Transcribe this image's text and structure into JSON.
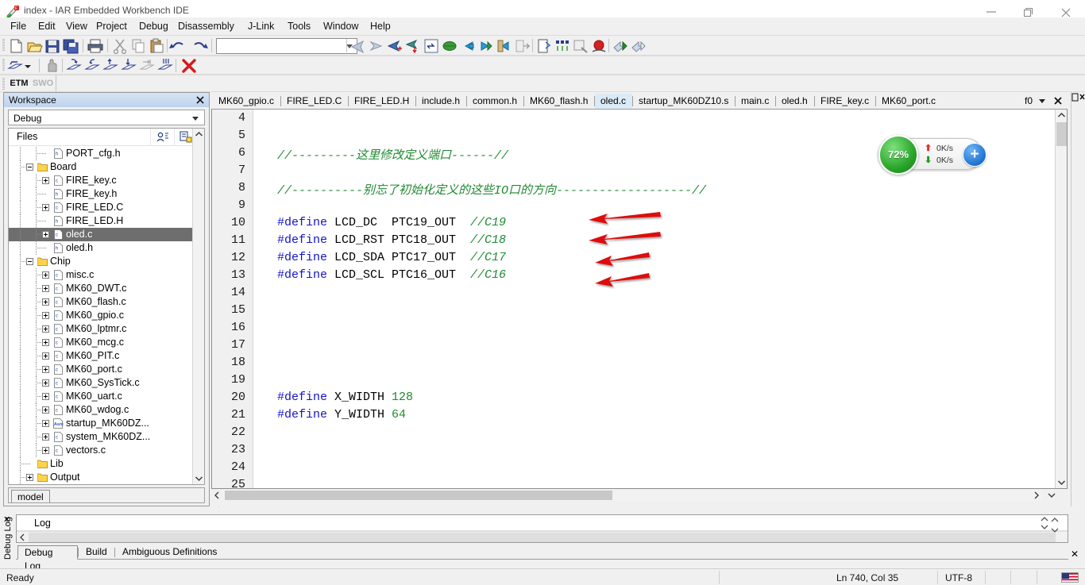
{
  "window": {
    "title": "index - IAR Embedded Workbench IDE",
    "app_icon": "iar-workbench-icon",
    "minimize": "─",
    "maximize": "❐",
    "close": "✕"
  },
  "menubar": {
    "items": [
      {
        "label": "File"
      },
      {
        "label": "Edit"
      },
      {
        "label": "View"
      },
      {
        "label": "Project"
      },
      {
        "label": "Debug"
      },
      {
        "label": "Disassembly"
      },
      {
        "label": "J-Link"
      },
      {
        "label": "Tools"
      },
      {
        "label": "Window"
      },
      {
        "label": "Help"
      }
    ]
  },
  "toolbar": {
    "main_icons": [
      "new-document-icon",
      "open-folder-icon",
      "save-icon",
      "save-all-icon",
      "print-icon",
      "cut-scissors-icon",
      "copy-icon",
      "paste-icon",
      "undo-icon",
      "redo-icon"
    ],
    "search_combo_value": "",
    "debug_icons": [
      "reset-icon",
      "break-icon",
      "step-over-icon",
      "step-into-icon",
      "step-out-icon",
      "next-statement-icon",
      "run-to-cursor-icon",
      "go-back-icon",
      "go-forward-icon",
      "goto-icon",
      "navigate-icon",
      "bookmark-icon",
      "toggle-breakpoint-icon",
      "view-breakpoints-icon",
      "stop-debug-icon",
      "download-debug-icon",
      "debug-without-download-icon"
    ],
    "debug_row_icons": [
      "step-dropdown-icon",
      "hand-icon",
      "step-over-2-icon",
      "step-into-2-icon",
      "step-out-2-icon",
      "next-stmt-2-icon",
      "run-to-cursor-2-icon",
      "multi-step-icon",
      "stop-debug-x-icon"
    ],
    "trace_buttons": [
      {
        "label": "ETM",
        "enabled": true
      },
      {
        "label": "SWO",
        "enabled": false
      }
    ]
  },
  "workspace": {
    "title": "Workspace",
    "close_icon": "close-icon",
    "config_value": "Debug",
    "files_header": "Files",
    "header_icons": [
      "user-config-icon",
      "build-config-icon"
    ],
    "bottom_tab": "model",
    "tree": [
      {
        "label": "PORT_cfg.h",
        "indent": 2,
        "icon": "header-file-icon",
        "expand": "none",
        "selected": false
      },
      {
        "label": "Board",
        "indent": 1,
        "icon": "folder-icon",
        "expand": "minus",
        "selected": false
      },
      {
        "label": "FIRE_key.c",
        "indent": 2,
        "icon": "c-file-icon",
        "expand": "plus",
        "selected": false
      },
      {
        "label": "FIRE_key.h",
        "indent": 2,
        "icon": "header-file-icon",
        "expand": "none",
        "selected": false
      },
      {
        "label": "FIRE_LED.C",
        "indent": 2,
        "icon": "c-file-icon",
        "expand": "plus",
        "selected": false
      },
      {
        "label": "FIRE_LED.H",
        "indent": 2,
        "icon": "header-file-icon",
        "expand": "none",
        "selected": false
      },
      {
        "label": "oled.c",
        "indent": 2,
        "icon": "c-file-icon",
        "expand": "plus",
        "selected": true
      },
      {
        "label": "oled.h",
        "indent": 2,
        "icon": "header-file-icon",
        "expand": "none",
        "selected": false
      },
      {
        "label": "Chip",
        "indent": 1,
        "icon": "folder-icon",
        "expand": "minus",
        "selected": false
      },
      {
        "label": "misc.c",
        "indent": 2,
        "icon": "c-file-icon",
        "expand": "plus",
        "selected": false
      },
      {
        "label": "MK60_DWT.c",
        "indent": 2,
        "icon": "c-file-icon",
        "expand": "plus",
        "selected": false
      },
      {
        "label": "MK60_flash.c",
        "indent": 2,
        "icon": "c-file-icon",
        "expand": "plus",
        "selected": false
      },
      {
        "label": "MK60_gpio.c",
        "indent": 2,
        "icon": "c-file-icon",
        "expand": "plus",
        "selected": false
      },
      {
        "label": "MK60_lptmr.c",
        "indent": 2,
        "icon": "c-file-icon",
        "expand": "plus",
        "selected": false
      },
      {
        "label": "MK60_mcg.c",
        "indent": 2,
        "icon": "c-file-icon",
        "expand": "plus",
        "selected": false
      },
      {
        "label": "MK60_PIT.c",
        "indent": 2,
        "icon": "c-file-icon",
        "expand": "plus",
        "selected": false
      },
      {
        "label": "MK60_port.c",
        "indent": 2,
        "icon": "c-file-icon",
        "expand": "plus",
        "selected": false
      },
      {
        "label": "MK60_SysTick.c",
        "indent": 2,
        "icon": "c-file-icon",
        "expand": "plus",
        "selected": false
      },
      {
        "label": "MK60_uart.c",
        "indent": 2,
        "icon": "c-file-icon",
        "expand": "plus",
        "selected": false
      },
      {
        "label": "MK60_wdog.c",
        "indent": 2,
        "icon": "c-file-icon",
        "expand": "plus",
        "selected": false
      },
      {
        "label": "startup_MK60DZ...",
        "indent": 2,
        "icon": "asm-file-icon",
        "expand": "plus",
        "selected": false
      },
      {
        "label": "system_MK60DZ...",
        "indent": 2,
        "icon": "c-file-icon",
        "expand": "plus",
        "selected": false
      },
      {
        "label": "vectors.c",
        "indent": 2,
        "icon": "c-file-icon",
        "expand": "plus",
        "selected": false
      },
      {
        "label": "Lib",
        "indent": 1,
        "icon": "folder-icon",
        "expand": "none",
        "selected": false
      },
      {
        "label": "Output",
        "indent": 1,
        "icon": "folder-icon",
        "expand": "plus",
        "selected": false
      }
    ]
  },
  "editor": {
    "tabs": [
      {
        "label": "MK60_gpio.c",
        "active": false
      },
      {
        "label": "FIRE_LED.C",
        "active": false
      },
      {
        "label": "FIRE_LED.H",
        "active": false
      },
      {
        "label": "include.h",
        "active": false
      },
      {
        "label": "common.h",
        "active": false
      },
      {
        "label": "MK60_flash.h",
        "active": false
      },
      {
        "label": "oled.c",
        "active": true
      },
      {
        "label": "startup_MK60DZ10.s",
        "active": false
      },
      {
        "label": "main.c",
        "active": false
      },
      {
        "label": "oled.h",
        "active": false
      },
      {
        "label": "FIRE_key.c",
        "active": false
      },
      {
        "label": "MK60_port.c",
        "active": false
      }
    ],
    "tabbar_right_label": "f0",
    "tabbar_dropdown_icon": "chevron-down-icon",
    "tabbar_close_icon": "close-icon",
    "lines": [
      {
        "n": "4",
        "segments": []
      },
      {
        "n": "5",
        "segments": []
      },
      {
        "n": "6",
        "segments": [
          {
            "t": "//---------这里修改定义端口------//",
            "c": "cm"
          }
        ]
      },
      {
        "n": "7",
        "segments": []
      },
      {
        "n": "8",
        "segments": [
          {
            "t": "//----------别忘了初始化定义的这些IO口的方向-------------------//",
            "c": "cm"
          }
        ]
      },
      {
        "n": "9",
        "segments": []
      },
      {
        "n": "10",
        "segments": [
          {
            "t": "#define",
            "c": "kw"
          },
          {
            "t": " LCD_DC  PTC19_OUT  ",
            "c": "id"
          },
          {
            "t": "//C19",
            "c": "cm"
          }
        ]
      },
      {
        "n": "11",
        "segments": [
          {
            "t": "#define",
            "c": "kw"
          },
          {
            "t": " LCD_RST PTC18_OUT  ",
            "c": "id"
          },
          {
            "t": "//C18",
            "c": "cm"
          }
        ]
      },
      {
        "n": "12",
        "segments": [
          {
            "t": "#define",
            "c": "kw"
          },
          {
            "t": " LCD_SDA PTC17_OUT  ",
            "c": "id"
          },
          {
            "t": "//C17",
            "c": "cm"
          }
        ]
      },
      {
        "n": "13",
        "segments": [
          {
            "t": "#define",
            "c": "kw"
          },
          {
            "t": " LCD_SCL PTC16_OUT  ",
            "c": "id"
          },
          {
            "t": "//C16",
            "c": "cm"
          }
        ]
      },
      {
        "n": "14",
        "segments": []
      },
      {
        "n": "15",
        "segments": []
      },
      {
        "n": "16",
        "segments": []
      },
      {
        "n": "17",
        "segments": []
      },
      {
        "n": "18",
        "segments": []
      },
      {
        "n": "19",
        "segments": []
      },
      {
        "n": "20",
        "segments": [
          {
            "t": "#define",
            "c": "kw"
          },
          {
            "t": " X_WIDTH ",
            "c": "id"
          },
          {
            "t": "128",
            "c": "num"
          }
        ]
      },
      {
        "n": "21",
        "segments": [
          {
            "t": "#define",
            "c": "kw"
          },
          {
            "t": " Y_WIDTH ",
            "c": "id"
          },
          {
            "t": "64",
            "c": "num"
          }
        ]
      },
      {
        "n": "22",
        "segments": []
      },
      {
        "n": "23",
        "segments": []
      },
      {
        "n": "24",
        "segments": []
      },
      {
        "n": "25",
        "segments": []
      }
    ]
  },
  "speed_widget": {
    "percent": "72%",
    "up_arrow_icon": "upload-arrow-icon",
    "down_arrow_icon": "download-arrow-icon",
    "upload_speed": "0K/s",
    "download_speed": "0K/s",
    "plus_label": "+",
    "badge_icon": "notification-dot-icon",
    "circle_color": "#27a327",
    "plus_color": "#1f72d0",
    "badge_color": "#e62020"
  },
  "annotations": {
    "arrow_color": "#dd1111",
    "arrows": [
      {
        "name": "arrow-to-lcd-dc"
      },
      {
        "name": "arrow-to-lcd-rst"
      },
      {
        "name": "arrow-to-lcd-sda"
      },
      {
        "name": "arrow-to-lcd-scl"
      }
    ]
  },
  "log_panel": {
    "vertical_tab": "Debug Log",
    "vertical_close_icon": "close-icon",
    "column_header": "Log",
    "scroll_left_icon": "chevron-left-icon",
    "tabs": [
      {
        "label": "Debug Log",
        "active": true
      },
      {
        "label": "Build",
        "active": false
      },
      {
        "label": "Ambiguous Definitions",
        "active": false
      }
    ],
    "close_icon": "close-icon"
  },
  "statusbar": {
    "ready": "Ready",
    "cursor_position": "Ln 740, Col 35",
    "encoding": "UTF-8",
    "locale_icon": "us-flag-icon"
  }
}
